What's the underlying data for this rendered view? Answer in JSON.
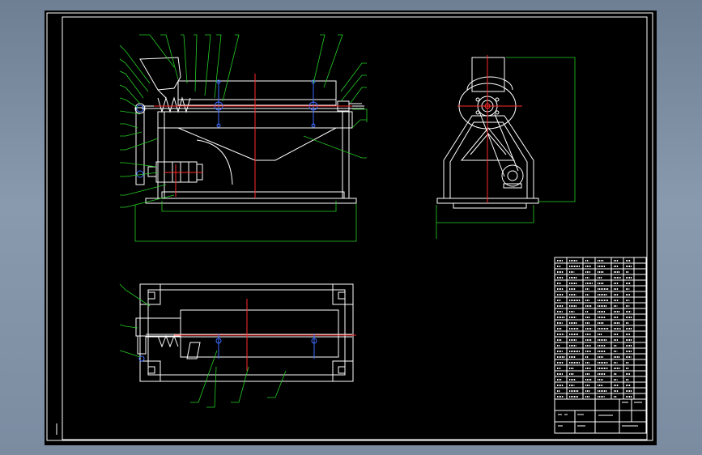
{
  "title_block": {
    "labels": [
      "",
      "",
      "",
      "",
      ""
    ]
  },
  "colors": {
    "background": "#000000",
    "outline": "#ffffff",
    "leader": "#25d025",
    "centerline": "#ff2a2a",
    "bearing": "#3b6bff",
    "viewport_gradient": "#7b8ba0"
  },
  "views": [
    "front-view",
    "side-view",
    "top-view",
    "parts-list",
    "title-block"
  ]
}
